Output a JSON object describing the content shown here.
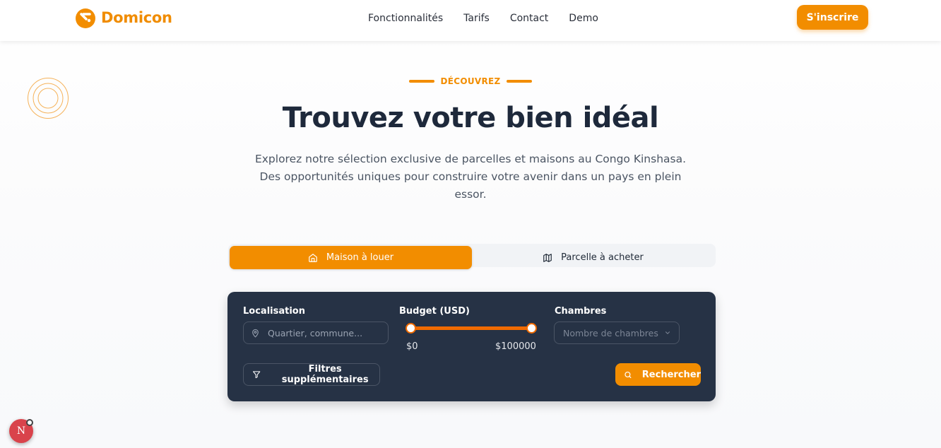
{
  "brand": {
    "name": "Domicon",
    "color": "#f28d00"
  },
  "nav": {
    "items": [
      "Fonctionnalités",
      "Tarifs",
      "Contact",
      "Demo"
    ],
    "signup_label": "S'inscrire"
  },
  "hero": {
    "eyebrow": "DÉCOUVREZ",
    "title": "Trouvez votre bien idéal",
    "subtitle": "Explorez notre sélection exclusive de parcelles et maisons au Congo Kinshasa. Des opportunités uniques pour construire votre avenir dans un pays en plein essor."
  },
  "tabs": [
    {
      "label": "Maison à louer",
      "icon": "home-icon",
      "active": true
    },
    {
      "label": "Parcelle à acheter",
      "icon": "map-icon",
      "active": false
    }
  ],
  "search": {
    "location": {
      "label": "Localisation",
      "placeholder": "Quartier, commune..."
    },
    "budget": {
      "label": "Budget (USD)",
      "min_label": "$0",
      "max_label": "$100000",
      "min": 0,
      "max": 100000
    },
    "rooms": {
      "label": "Chambres",
      "placeholder": "Nombre de chambres"
    },
    "filters_label": "Filtres supplémentaires",
    "submit_label": "Rechercher"
  },
  "dev_badge": {
    "letter": "N"
  }
}
